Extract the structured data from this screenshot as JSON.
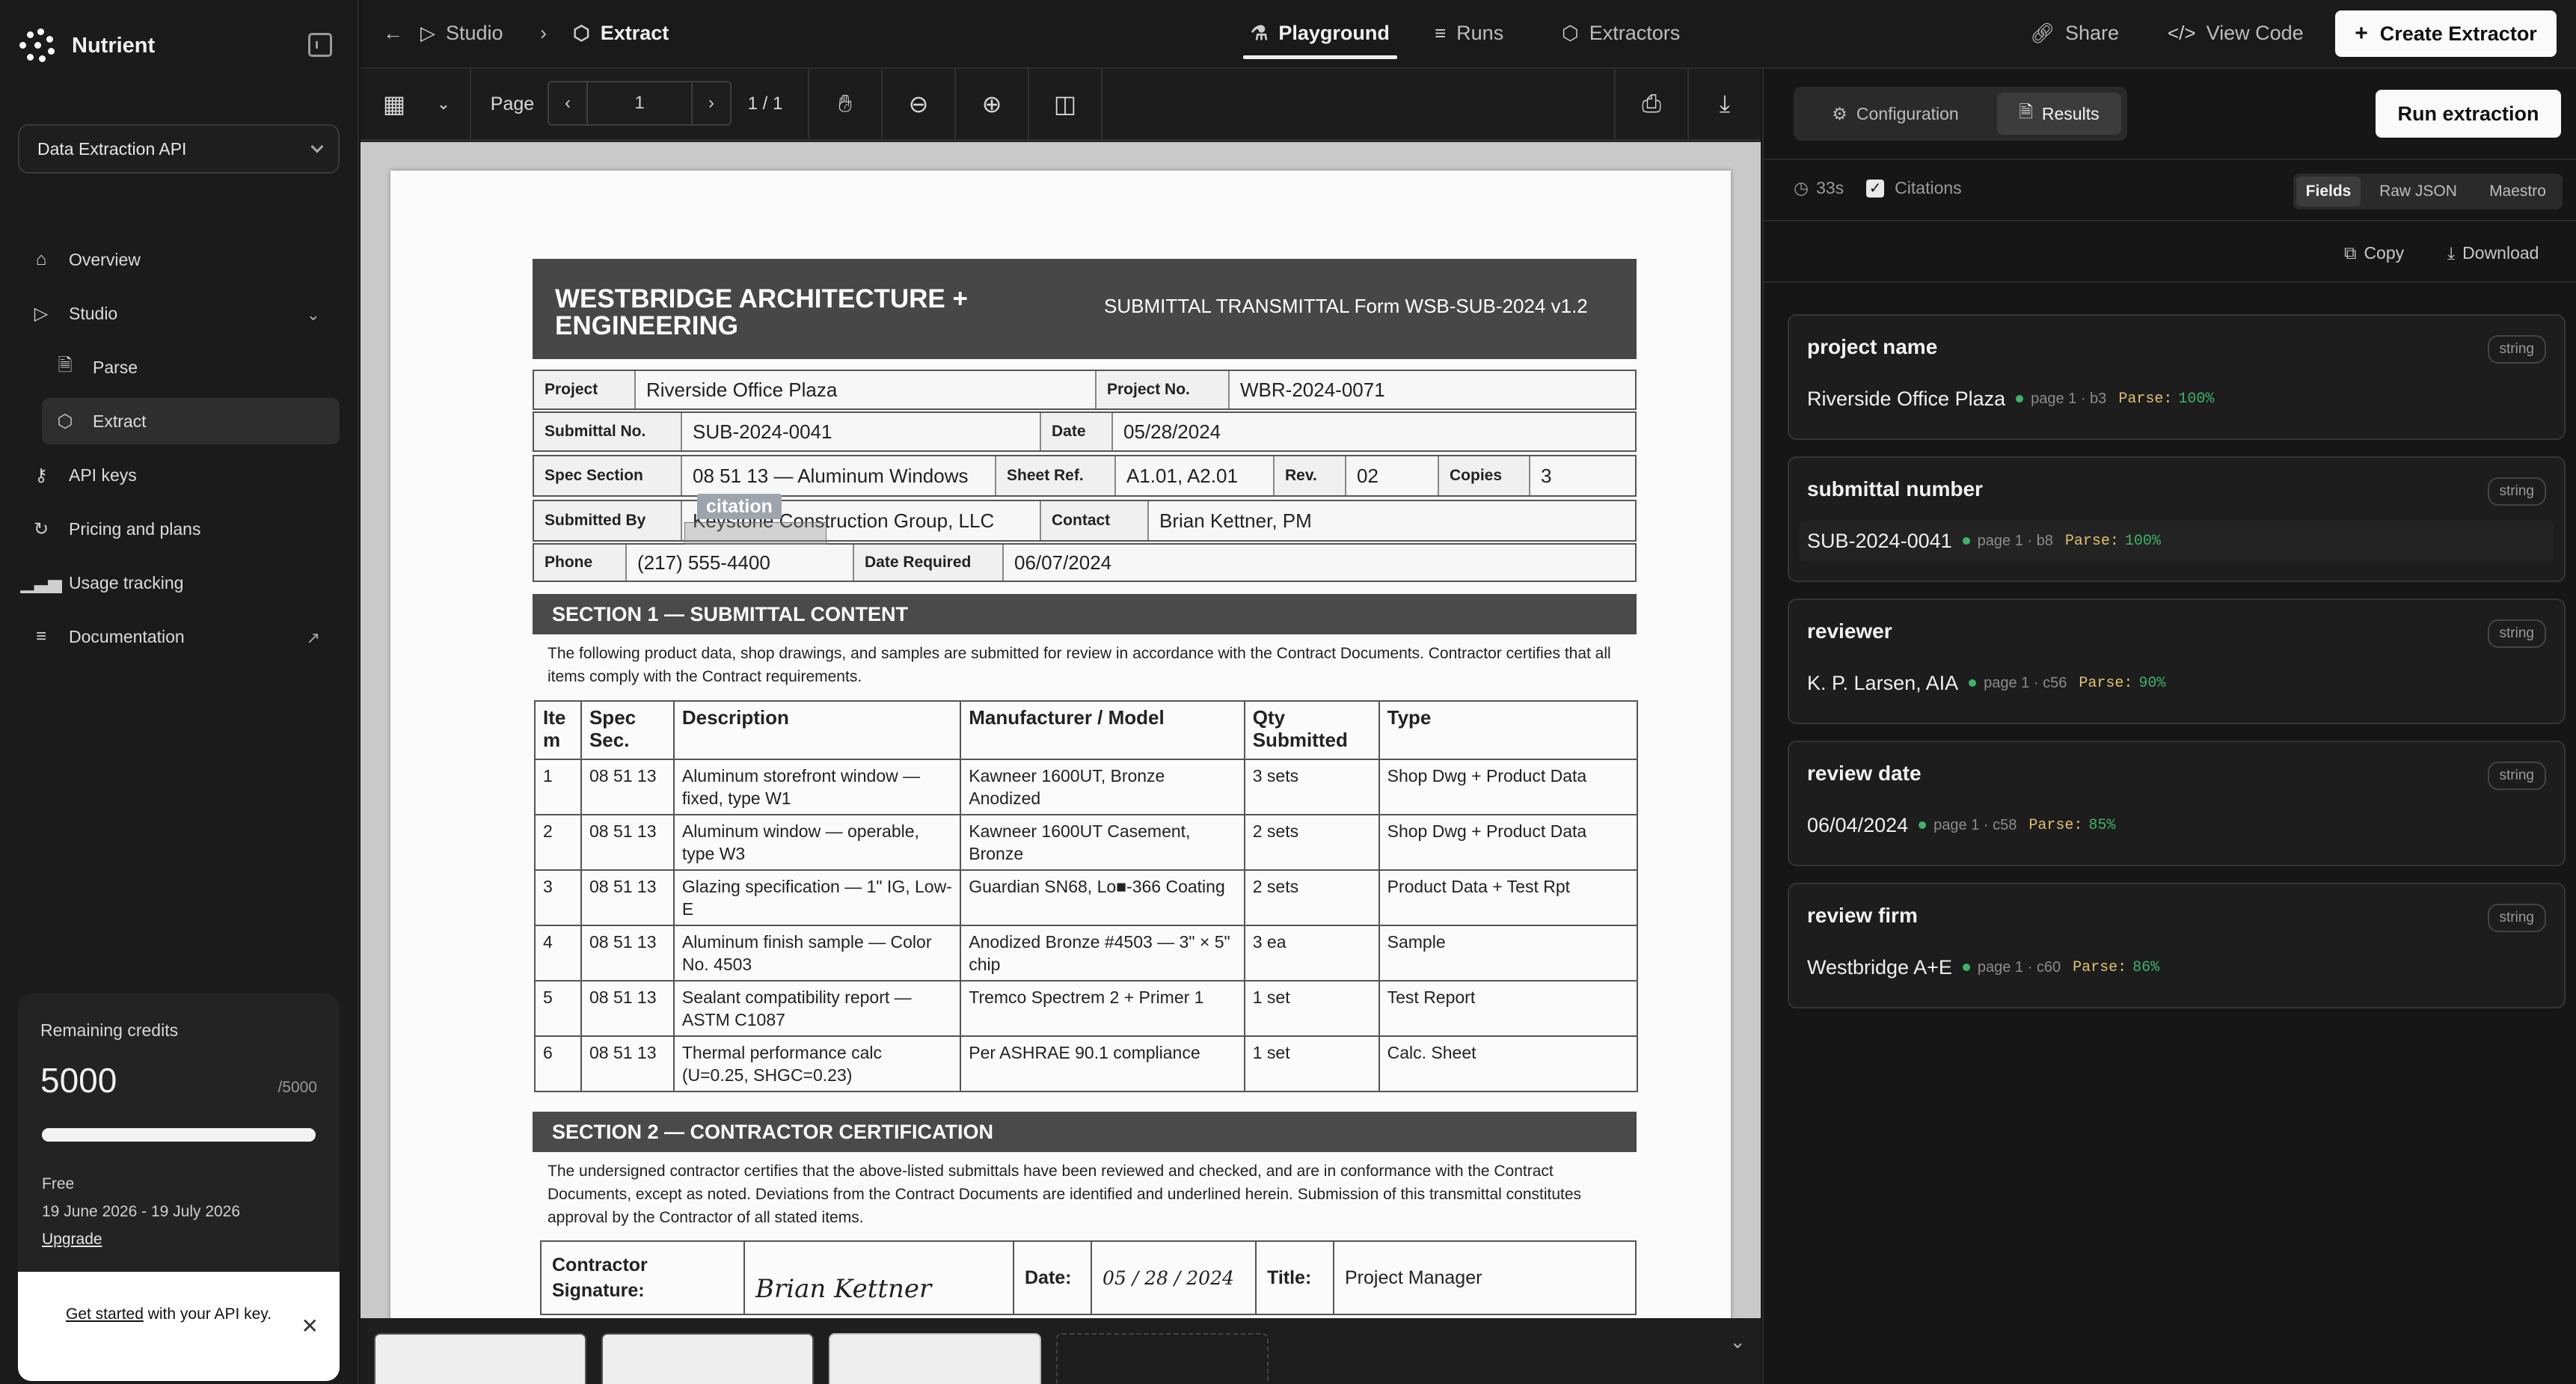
{
  "brand": {
    "name": "Nutrient"
  },
  "sidebar": {
    "api_select": "Data Extraction API",
    "items": [
      {
        "label": "Overview"
      },
      {
        "label": "Studio"
      },
      {
        "label": "Parse"
      },
      {
        "label": "Extract"
      },
      {
        "label": "API keys"
      },
      {
        "label": "Pricing and plans"
      },
      {
        "label": "Usage tracking"
      },
      {
        "label": "Documentation"
      }
    ],
    "credits": {
      "label": "Remaining credits",
      "value": "5000",
      "max": "/5000",
      "fill_fraction": 1.0,
      "plan": "Free",
      "period": "19 June 2026 - 19 July 2026",
      "upgrade": "Upgrade"
    },
    "get_started": {
      "link": "Get started",
      "rest": " with your API key."
    }
  },
  "topbar": {
    "breadcrumb": [
      "Studio",
      "Extract"
    ],
    "tabs": [
      "Playground",
      "Runs",
      "Extractors"
    ],
    "share": "Share",
    "view_code": "View Code",
    "create": "Create Extractor"
  },
  "viewer": {
    "page_label": "Page",
    "page_value": "1",
    "page_count": "1 / 1"
  },
  "document": {
    "firm": "WESTBRIDGE ARCHITECTURE + ENGINEERING",
    "form": "SUBMITTAL TRANSMITTAL Form WSB-SUB-2024 v1.2",
    "project_label": "Project",
    "project": "Riverside Office Plaza",
    "project_no_label": "Project No.",
    "project_no": "WBR-2024-0071",
    "submittal_label": "Submittal No.",
    "submittal": "SUB-2024-0041",
    "date_label": "Date",
    "date": "05/28/2024",
    "spec_label": "Spec Section",
    "spec": "08 51 13 — Aluminum Windows",
    "sheet_label": "Sheet Ref.",
    "sheet": "A1.01, A2.01",
    "rev_label": "Rev.",
    "rev": "02",
    "copies_label": "Copies",
    "copies": "3",
    "submitted_by_label": "Submitted By",
    "submitted_by": "Keystone Construction Group, LLC",
    "contact_label": "Contact",
    "contact": "Brian Kettner, PM",
    "phone_label": "Phone",
    "phone": "(217) 555-4400",
    "date_req_label": "Date Required",
    "date_req": "06/07/2024",
    "section1": "SECTION 1 — SUBMITTAL CONTENT",
    "section1_text": "The following product data, shop drawings, and samples are submitted for review in accordance with the Contract Documents. Contractor certifies that all items comply with the Contract requirements.",
    "table_headers": [
      "Ite m",
      "Spec Sec.",
      "Description",
      "Manufacturer / Model",
      "Qty Submitted",
      "Type"
    ],
    "table_rows": [
      [
        "1",
        "08 51 13",
        "Aluminum storefront window — fixed, type W1",
        "Kawneer 1600UT, Bronze Anodized",
        "3 sets",
        "Shop Dwg + Product Data"
      ],
      [
        "2",
        "08 51 13",
        "Aluminum window — operable, type W3",
        "Kawneer 1600UT Casement, Bronze",
        "2 sets",
        "Shop Dwg + Product Data"
      ],
      [
        "3",
        "08 51 13",
        "Glazing specification — 1\" IG, Low-E",
        "Guardian SN68, Lo■-366 Coating",
        "2 sets",
        "Product Data + Test Rpt"
      ],
      [
        "4",
        "08 51 13",
        "Aluminum finish sample — Color No. 4503",
        "Anodized Bronze #4503 — 3\" × 5\" chip",
        "3 ea",
        "Sample"
      ],
      [
        "5",
        "08 51 13",
        "Sealant compatibility report — ASTM C1087",
        "Tremco Spectrem 2 + Primer 1",
        "1 set",
        "Test Report"
      ],
      [
        "6",
        "08 51 13",
        "Thermal performance calc (U=0.25, SHGC=0.23)",
        "Per ASHRAE 90.1 compliance",
        "1 set",
        "Calc. Sheet"
      ]
    ],
    "section2": "SECTION 2 — CONTRACTOR CERTIFICATION",
    "section2_text": "The undersigned contractor certifies that the above-listed submittals have been reviewed and checked, and are in conformance with the Contract Documents, except as noted. Deviations from the Contract Documents are identified and underlined herein. Submission of this transmittal constitutes approval by the Contractor of all stated items.",
    "sig_label": "Contractor Signature:",
    "sig_name": "Brian Kettner",
    "sig_date_label": "Date:",
    "sig_date": "05 / 28 / 2024",
    "title_label": "Title:",
    "title": "Project Manager",
    "citation_tag": "citation"
  },
  "panel": {
    "tabs": [
      "Configuration",
      "Results"
    ],
    "run": "Run extraction",
    "time": "33s",
    "citations": "Citations",
    "views": [
      "Fields",
      "Raw JSON",
      "Maestro"
    ],
    "copy": "Copy",
    "download": "Download",
    "parse_label": "Parse:",
    "fields": [
      {
        "name": "project name",
        "type": "string",
        "value": "Riverside Office Plaza",
        "loc": "page 1 · b3",
        "pct": "100%"
      },
      {
        "name": "submittal number",
        "type": "string",
        "value": "SUB-2024-0041",
        "loc": "page 1 · b8",
        "pct": "100%"
      },
      {
        "name": "reviewer",
        "type": "string",
        "value": "K. P. Larsen, AIA",
        "loc": "page 1 · c56",
        "pct": "90%"
      },
      {
        "name": "review date",
        "type": "string",
        "value": "06/04/2024",
        "loc": "page 1 · c58",
        "pct": "85%"
      },
      {
        "name": "review firm",
        "type": "string",
        "value": "Westbridge A+E",
        "loc": "page 1 · c60",
        "pct": "86%"
      }
    ]
  }
}
